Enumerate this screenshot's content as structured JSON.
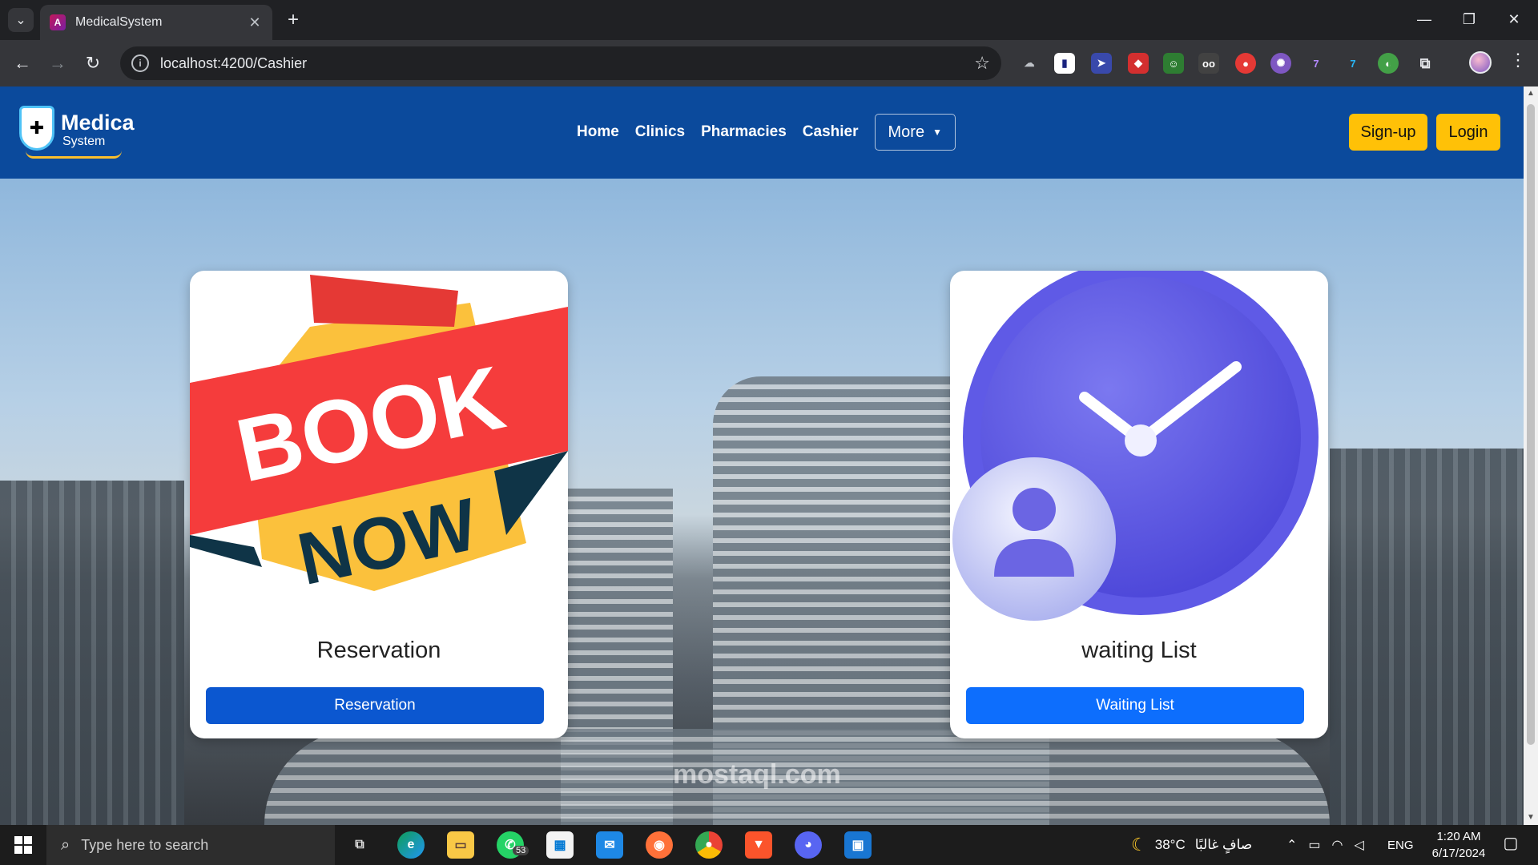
{
  "browser": {
    "tab_title": "MedicalSystem",
    "url": "localhost:4200/Cashier"
  },
  "site": {
    "logo_line1": "Medica",
    "logo_line2": "System",
    "nav": [
      "Home",
      "Clinics",
      "Pharmacies",
      "Cashier"
    ],
    "more_label": "More",
    "signup_label": "Sign-up",
    "login_label": "Login",
    "watermark": "mostaql.com"
  },
  "cards": {
    "reservation": {
      "image_text_1": "BOOK",
      "image_text_2": "NOW",
      "title": "Reservation",
      "button": "Reservation"
    },
    "waiting": {
      "title": "waiting List",
      "button": "Waiting List"
    }
  },
  "taskbar": {
    "search_placeholder": "Type here to search",
    "whatsapp_badge": "53",
    "weather_temp": "38°C",
    "weather_text": "صافٍ غالبًا",
    "language": "ENG",
    "time": "1:20 AM",
    "date": "6/17/2024"
  },
  "colors": {
    "site_nav": "#0b4a9c",
    "accent_yellow": "#ffc107",
    "btn_reservation": "#0b57d0",
    "btn_waiting": "#0d6efd"
  }
}
